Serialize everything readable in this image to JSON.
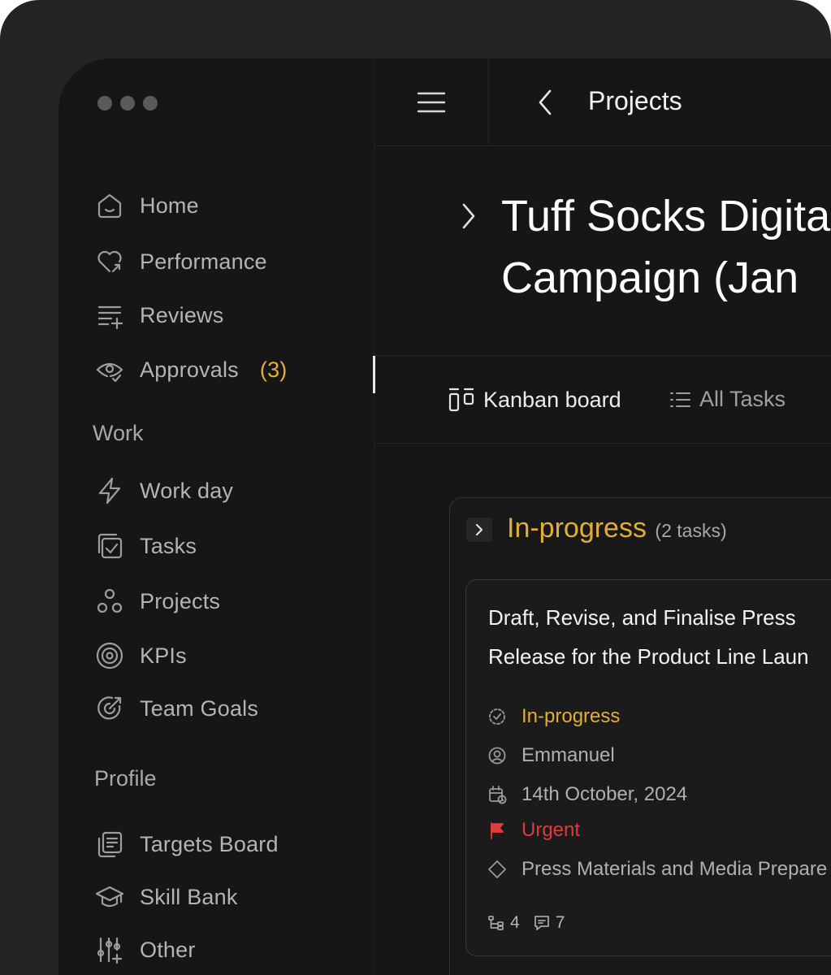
{
  "sidebar": {
    "main_items": [
      {
        "label": "Home",
        "icon": "home-icon"
      },
      {
        "label": "Performance",
        "icon": "heart-arrow-icon"
      },
      {
        "label": "Reviews",
        "icon": "list-add-icon"
      },
      {
        "label": "Approvals",
        "count": "(3)",
        "icon": "eye-check-icon"
      }
    ],
    "work_label": "Work",
    "work_items": [
      {
        "label": "Work day",
        "icon": "lightning-icon"
      },
      {
        "label": "Tasks",
        "icon": "tasks-check-icon"
      },
      {
        "label": "Projects",
        "icon": "projects-circles-icon"
      },
      {
        "label": "KPIs",
        "icon": "target-icon"
      },
      {
        "label": "Team Goals",
        "icon": "target-arrow-icon"
      }
    ],
    "profile_label": "Profile",
    "profile_items": [
      {
        "label": "Targets Board",
        "icon": "board-copy-icon"
      },
      {
        "label": "Skill Bank",
        "icon": "graduation-cap-icon"
      },
      {
        "label": "Other",
        "icon": "sliders-plus-icon"
      }
    ]
  },
  "topbar": {
    "title": "Projects"
  },
  "project": {
    "title_line1": "Tuff Socks Digita",
    "title_line2": "Campaign (Jan"
  },
  "tabs": {
    "kanban": "Kanban board",
    "all_tasks": "All Tasks"
  },
  "column": {
    "name": "In-progress",
    "count": "(2 tasks)"
  },
  "card": {
    "title_line1": "Draft, Revise, and Finalise Press",
    "title_line2": "Release for the Product Line Laun",
    "status": "In-progress",
    "assignee": "Emmanuel",
    "due_date": "14th October, 2024",
    "priority": "Urgent",
    "category": "Press Materials and Media Prepare",
    "subtasks": "4",
    "comments": "7"
  },
  "colors": {
    "accent": "#e3ad3c",
    "urgent": "#e03b3b",
    "background": "#161616"
  }
}
